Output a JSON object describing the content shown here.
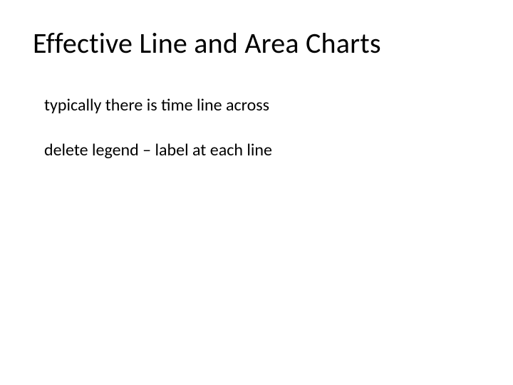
{
  "slide": {
    "title": "Effective Line and Area Charts",
    "bullets": [
      "typically there is time line across",
      "delete legend – label at each line"
    ]
  }
}
